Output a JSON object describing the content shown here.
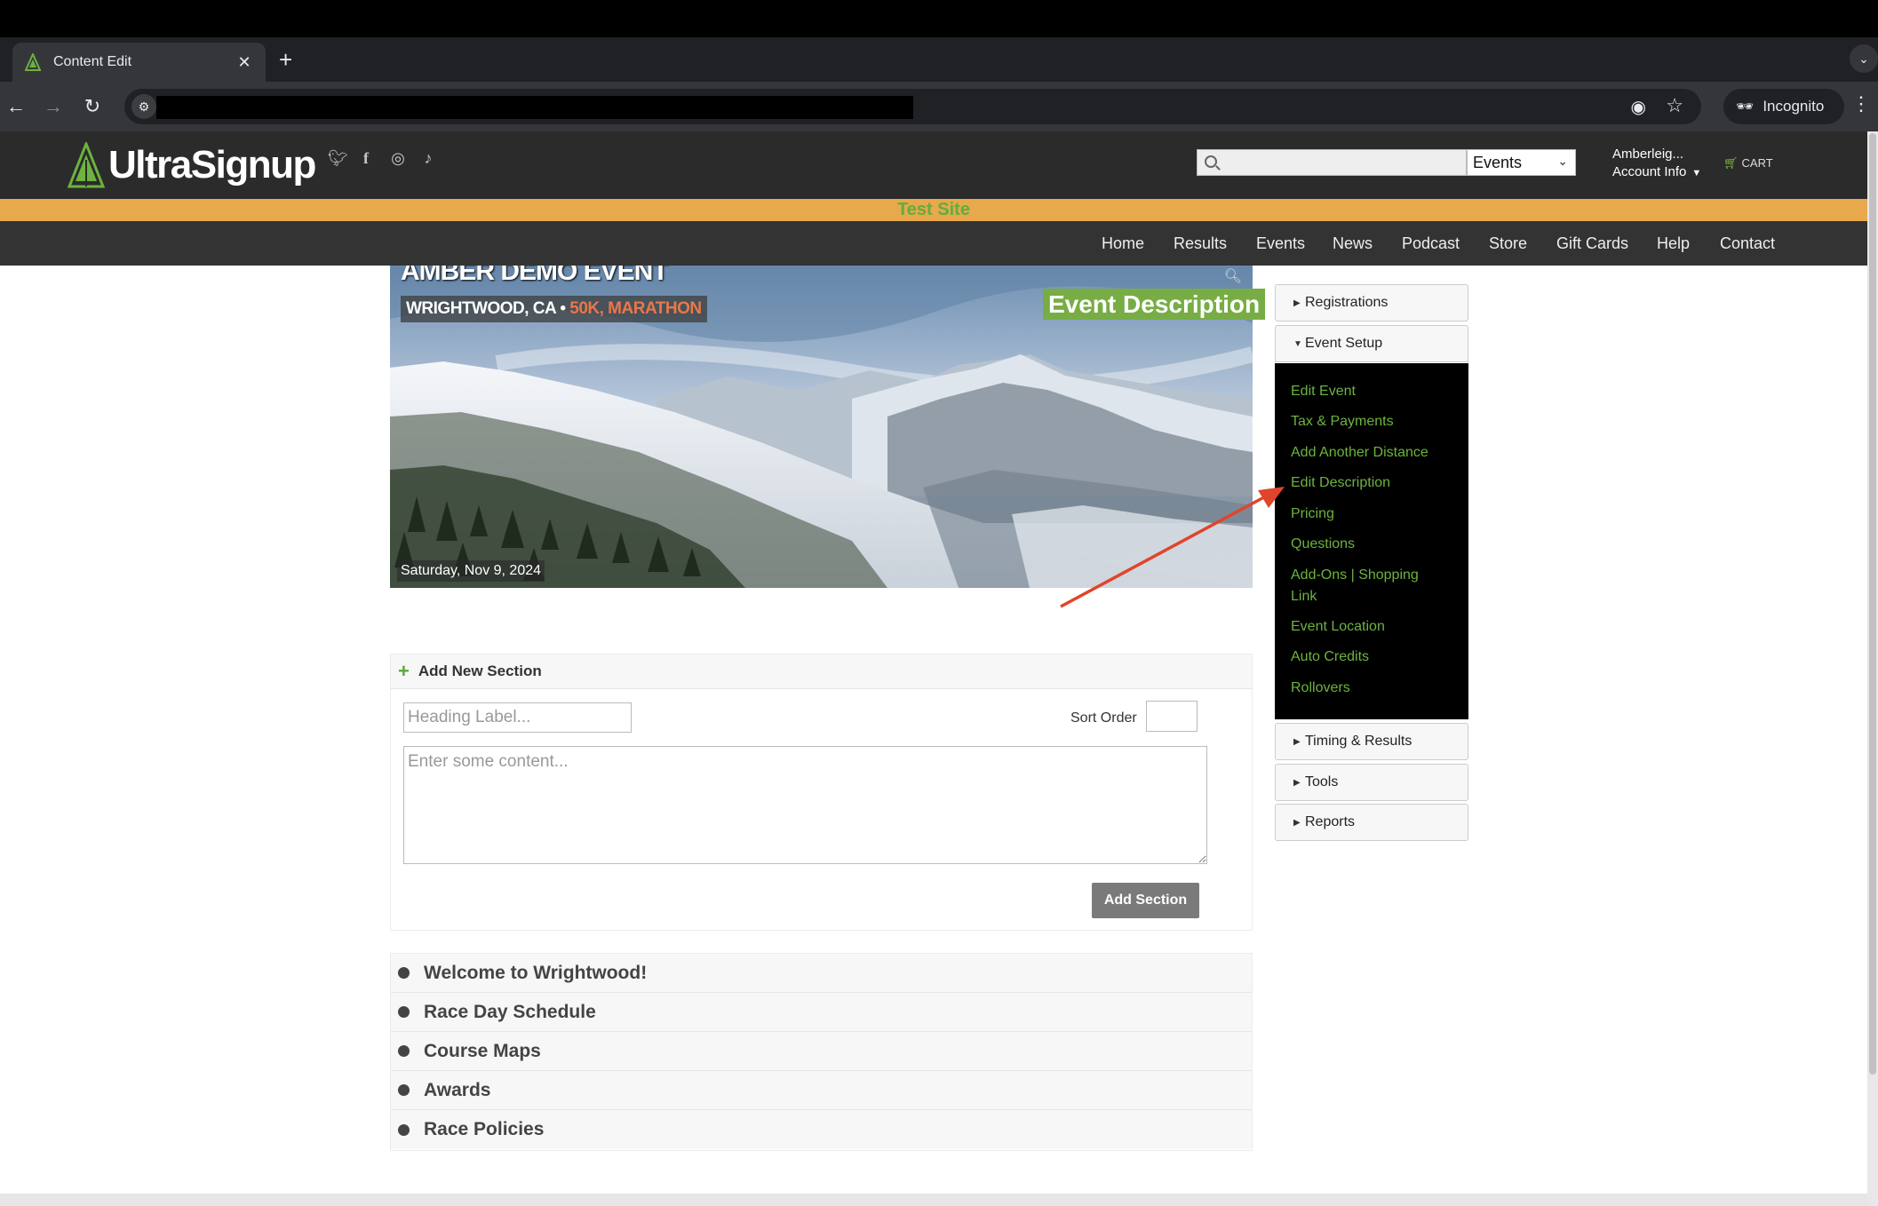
{
  "browser": {
    "tab_title": "Content Edit",
    "incognito_label": "Incognito"
  },
  "site": {
    "logo_text": "UltraSignup",
    "search": {
      "placeholder": "",
      "scope_selected": "Events"
    },
    "account": {
      "name": "Amberleig...",
      "menu_label": "Account Info"
    },
    "cart_label": "CART",
    "test_banner": "Test Site",
    "nav": [
      "Home",
      "Results",
      "Events",
      "News",
      "Podcast",
      "Store",
      "Gift Cards",
      "Help",
      "Contact"
    ]
  },
  "hero": {
    "event_title": "AMBER DEMO EVENT",
    "location": "WRIGHTWOOD, CA",
    "separator": "•",
    "distances": "50K, MARATHON",
    "date": "Saturday, Nov 9, 2024",
    "page_label": "Event Description"
  },
  "sidebar": {
    "registrations": "Registrations",
    "event_setup": "Event Setup",
    "event_setup_links": [
      "Edit Event",
      "Tax & Payments",
      "Add Another Distance",
      "Edit Description",
      "Pricing",
      "Questions",
      "Add-Ons | Shopping Link",
      "Event Location",
      "Auto Credits",
      "Rollovers"
    ],
    "timing_results": "Timing & Results",
    "tools": "Tools",
    "reports": "Reports"
  },
  "add_section": {
    "header": "Add New Section",
    "heading_placeholder": "Heading Label...",
    "sort_order_label": "Sort Order",
    "content_placeholder": "Enter some content...",
    "button": "Add Section"
  },
  "sections": [
    "Welcome to Wrightwood!",
    "Race Day Schedule",
    "Course Maps",
    "Awards",
    "Race Policies"
  ],
  "colors": {
    "brand_green": "#6cb33f",
    "test_banner_bg": "#e8a84c",
    "header_bg": "#2b2b2b",
    "nav_bg": "#333333",
    "annotation_arrow": "#e0452b"
  },
  "icons": {
    "social": [
      "twitter-icon",
      "facebook-icon",
      "instagram-icon",
      "tiktok-icon"
    ]
  }
}
